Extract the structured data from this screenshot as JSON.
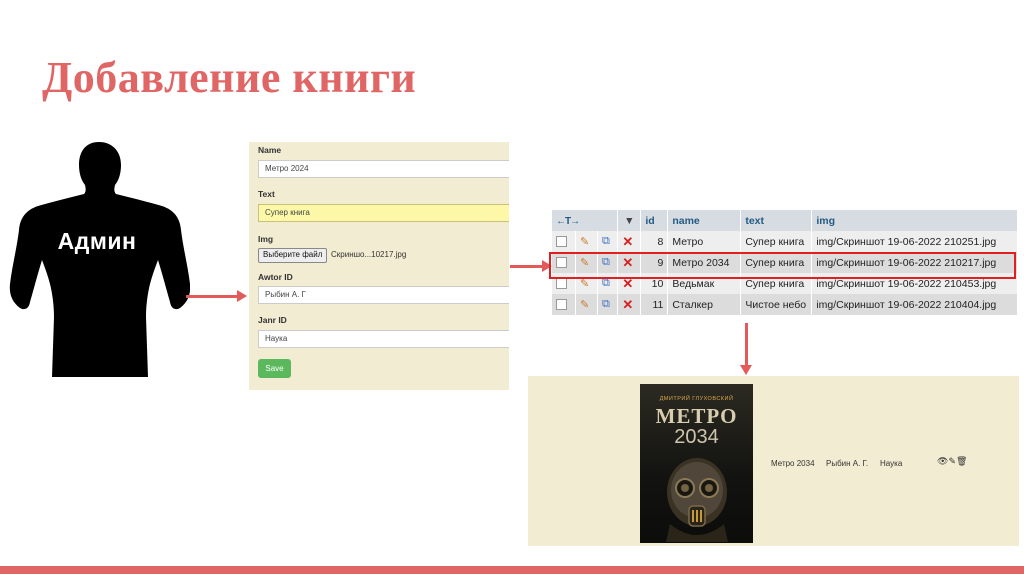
{
  "slide": {
    "title": "Добавление книги"
  },
  "admin": {
    "label": "Админ"
  },
  "form": {
    "name_label": "Name",
    "name_value": "Метро 2024",
    "text_label": "Text",
    "text_value": "Супер книга",
    "img_label": "Img",
    "file_button": "Выберите файл",
    "file_name": "Скриншо...10217.jpg",
    "author_label": "Awtor ID",
    "author_value": "Рыбин А. Г",
    "genre_label": "Janr ID",
    "genre_value": "Наука",
    "save_label": "Save"
  },
  "table": {
    "nav_arrows": "←T→",
    "sort_icon": "sort-down-icon",
    "columns": [
      "id",
      "name",
      "text",
      "img"
    ],
    "rows": [
      {
        "id": "8",
        "name": "Метро",
        "text": "Супер книга",
        "img": "img/Скриншот 19-06-2022 210251.jpg"
      },
      {
        "id": "9",
        "name": "Метро 2034",
        "text": "Супер книга",
        "img": "img/Скриншот 19-06-2022 210217.jpg"
      },
      {
        "id": "10",
        "name": "Ведьмак",
        "text": "Супер книга",
        "img": "img/Скриншот 19-06-2022 210453.jpg"
      },
      {
        "id": "11",
        "name": "Сталкер",
        "text": "Чистое небо",
        "img": "img/Скриншот 19-06-2022 210404.jpg"
      }
    ]
  },
  "result": {
    "cover_author": "ДМИТРИЙ ГЛУХОВСКИЙ",
    "cover_title": "МЕТРО",
    "cover_year": "2034",
    "name": "Метро 2034",
    "author": "Рыбин А. Г.",
    "genre": "Наука",
    "actions": [
      "eye-icon",
      "pencil-icon",
      "trash-icon"
    ]
  },
  "colors": {
    "accent": "#e06666",
    "arrow": "#e35a5a",
    "panel": "#f1ecd2",
    "save": "#5cb85c"
  }
}
